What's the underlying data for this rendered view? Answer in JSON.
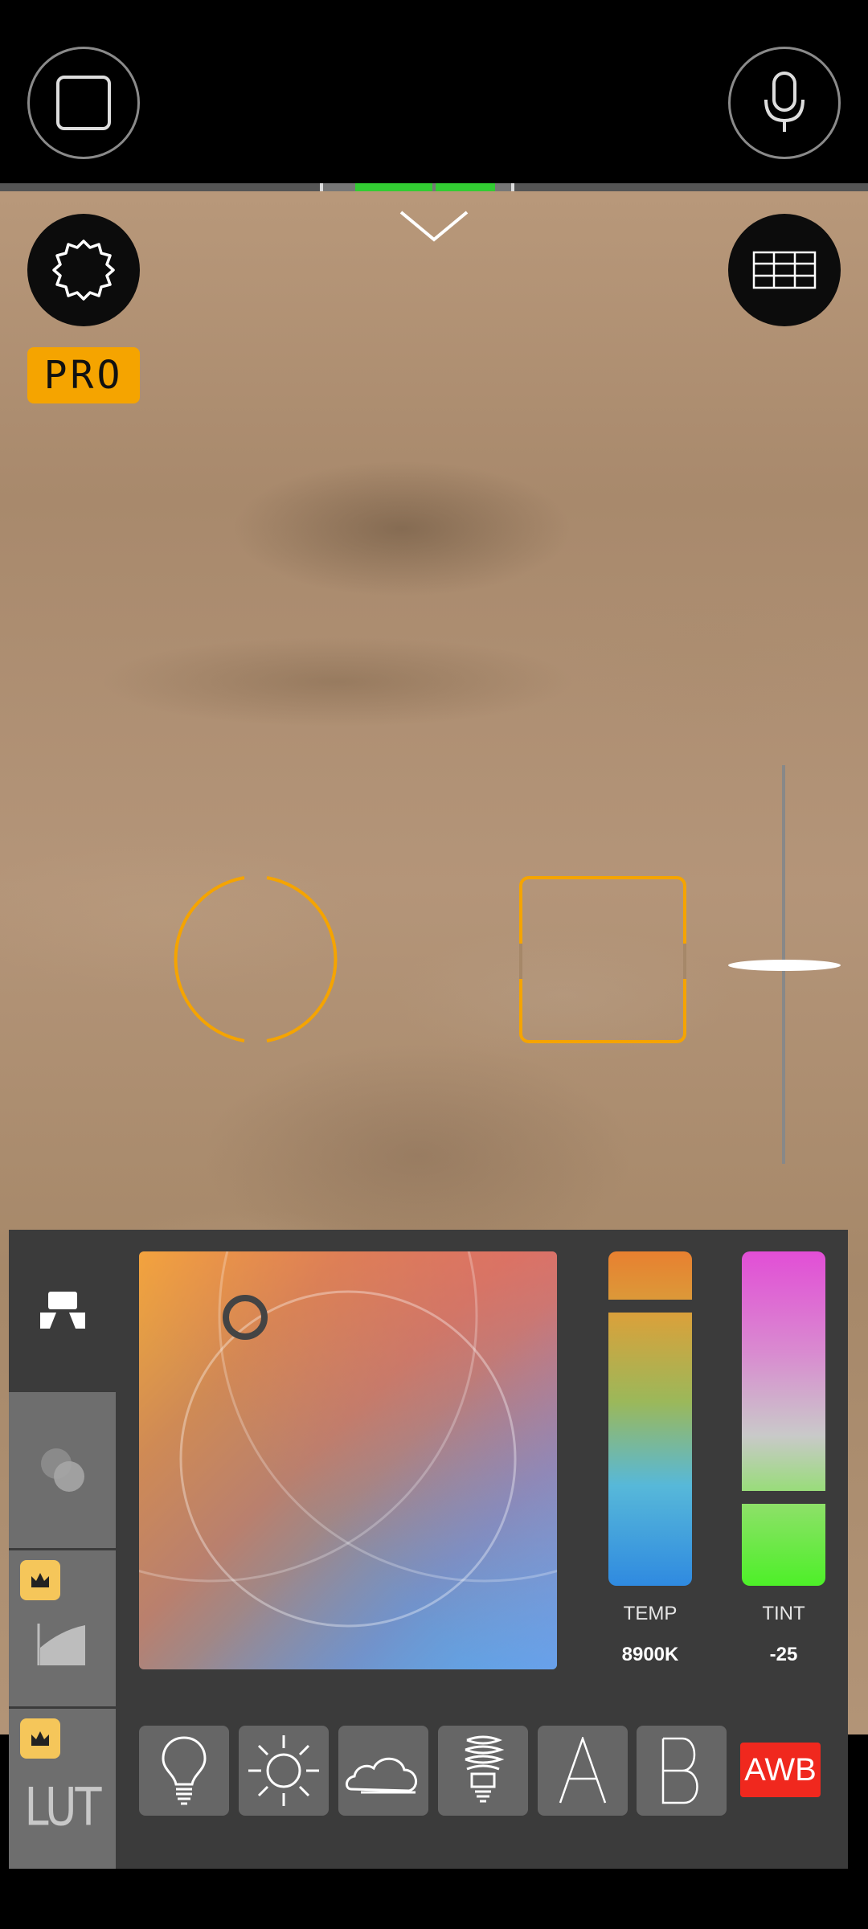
{
  "top_bar": {
    "left_icon": "aspect-frame-icon",
    "right_icon": "microphone-icon"
  },
  "viewfinder": {
    "collapse_icon": "chevron-down-icon",
    "settings_icon": "gear-icon",
    "grid_icon": "grid-icon",
    "pro_label": "PRO"
  },
  "white_balance": {
    "side_tabs": [
      {
        "name": "white-balance-tab",
        "icon": "white-balance-icon",
        "locked": false,
        "label": ""
      },
      {
        "name": "color-mix-tab",
        "icon": "overlapping-circles-icon",
        "locked": false,
        "label": ""
      },
      {
        "name": "curve-tab",
        "icon": "curve-icon",
        "locked": true,
        "label": ""
      },
      {
        "name": "lut-tab",
        "icon": "lut-icon",
        "locked": true,
        "label": "LUT"
      }
    ],
    "temp_label": "TEMP",
    "temp_value": "8900K",
    "tint_label": "TINT",
    "tint_value": "-25",
    "temp_level": 0.85,
    "tint_level": 0.25,
    "presets": [
      {
        "name": "incandescent-preset",
        "icon": "lightbulb-icon",
        "label": ""
      },
      {
        "name": "daylight-preset",
        "icon": "sun-icon",
        "label": ""
      },
      {
        "name": "cloudy-preset",
        "icon": "cloud-icon",
        "label": ""
      },
      {
        "name": "fluorescent-preset",
        "icon": "cfl-bulb-icon",
        "label": ""
      },
      {
        "name": "custom-a-preset",
        "icon": "",
        "label": "A"
      },
      {
        "name": "custom-b-preset",
        "icon": "",
        "label": "B"
      }
    ],
    "awb_label": "AWB",
    "colors": {
      "accent": "#f5a400",
      "awb_bg": "#f0281e",
      "histogram_green": "#33cc33"
    }
  }
}
